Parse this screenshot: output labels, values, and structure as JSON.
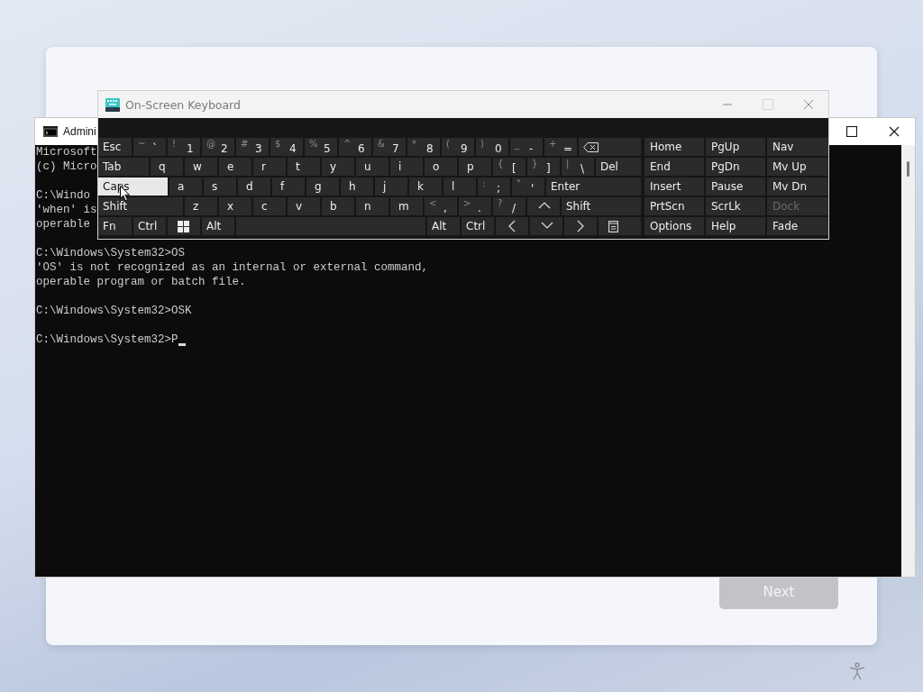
{
  "setup_card": {
    "next_button": {
      "label": "Next",
      "disabled": true
    }
  },
  "cmd_window": {
    "title": "Admini",
    "blocks": [
      [
        "Microsoft",
        "(c) Micro"
      ],
      [
        "C:\\Windo",
        "'when' is",
        "operable"
      ],
      [
        "C:\\Windows\\System32>OS",
        "'OS' is not recognized as an internal or external command,",
        "operable program or batch file."
      ],
      [
        "C:\\Windows\\System32>OSK"
      ],
      [
        "C:\\Windows\\System32>P"
      ]
    ]
  },
  "osk": {
    "title": "On-Screen Keyboard",
    "rows": [
      [
        {
          "kind": "label",
          "label": "Esc",
          "highlighted": false
        },
        {
          "kind": "pair",
          "shift": "~",
          "label": "`",
          "highlighted": false
        },
        {
          "kind": "pair",
          "shift": "!",
          "label": "1",
          "highlighted": false
        },
        {
          "kind": "pair",
          "shift": "@",
          "label": "2",
          "highlighted": false
        },
        {
          "kind": "pair",
          "shift": "#",
          "label": "3",
          "highlighted": false
        },
        {
          "kind": "pair",
          "shift": "$",
          "label": "4",
          "highlighted": false
        },
        {
          "kind": "pair",
          "shift": "%",
          "label": "5",
          "highlighted": false
        },
        {
          "kind": "pair",
          "shift": "^",
          "label": "6",
          "highlighted": false
        },
        {
          "kind": "pair",
          "shift": "&",
          "label": "7",
          "highlighted": false
        },
        {
          "kind": "pair",
          "shift": "*",
          "label": "8",
          "highlighted": false
        },
        {
          "kind": "pair",
          "shift": "(",
          "label": "9",
          "highlighted": false
        },
        {
          "kind": "pair",
          "shift": ")",
          "label": "0",
          "highlighted": false
        },
        {
          "kind": "pair",
          "shift": "_",
          "label": "-",
          "highlighted": false
        },
        {
          "kind": "pair",
          "shift": "+",
          "label": "=",
          "highlighted": false
        },
        {
          "kind": "backspace",
          "highlighted": false
        }
      ],
      [
        {
          "kind": "label",
          "label": "Tab",
          "highlighted": false
        },
        {
          "kind": "char",
          "label": "q",
          "highlighted": false
        },
        {
          "kind": "char",
          "label": "w",
          "highlighted": false
        },
        {
          "kind": "char",
          "label": "e",
          "highlighted": false
        },
        {
          "kind": "char",
          "label": "r",
          "highlighted": false
        },
        {
          "kind": "char",
          "label": "t",
          "highlighted": false
        },
        {
          "kind": "char",
          "label": "y",
          "highlighted": false
        },
        {
          "kind": "char",
          "label": "u",
          "highlighted": false
        },
        {
          "kind": "char",
          "label": "i",
          "highlighted": false
        },
        {
          "kind": "char",
          "label": "o",
          "highlighted": false
        },
        {
          "kind": "char",
          "label": "p",
          "highlighted": false
        },
        {
          "kind": "pair",
          "shift": "{",
          "label": "[",
          "highlighted": false
        },
        {
          "kind": "pair",
          "shift": "}",
          "label": "]",
          "highlighted": false
        },
        {
          "kind": "pair",
          "shift": "|",
          "label": "\\",
          "highlighted": false
        },
        {
          "kind": "label",
          "label": "Del",
          "highlighted": false
        }
      ],
      [
        {
          "kind": "label",
          "label": "Caps",
          "highlighted": true
        },
        {
          "kind": "char",
          "label": "a",
          "highlighted": false
        },
        {
          "kind": "char",
          "label": "s",
          "highlighted": false
        },
        {
          "kind": "char",
          "label": "d",
          "highlighted": false
        },
        {
          "kind": "char",
          "label": "f",
          "highlighted": false
        },
        {
          "kind": "char",
          "label": "g",
          "highlighted": false
        },
        {
          "kind": "char",
          "label": "h",
          "highlighted": false
        },
        {
          "kind": "char",
          "label": "j",
          "highlighted": false
        },
        {
          "kind": "char",
          "label": "k",
          "highlighted": false
        },
        {
          "kind": "char",
          "label": "l",
          "highlighted": false
        },
        {
          "kind": "pair",
          "shift": ":",
          "label": ";",
          "highlighted": false
        },
        {
          "kind": "pair",
          "shift": "\"",
          "label": "'",
          "highlighted": false
        },
        {
          "kind": "label",
          "label": "Enter",
          "highlighted": false
        }
      ],
      [
        {
          "kind": "label",
          "label": "Shift",
          "highlighted": false
        },
        {
          "kind": "char",
          "label": "z",
          "highlighted": false
        },
        {
          "kind": "char",
          "label": "x",
          "highlighted": false
        },
        {
          "kind": "char",
          "label": "c",
          "highlighted": false
        },
        {
          "kind": "char",
          "label": "v",
          "highlighted": false
        },
        {
          "kind": "char",
          "label": "b",
          "highlighted": false
        },
        {
          "kind": "char",
          "label": "n",
          "highlighted": false
        },
        {
          "kind": "char",
          "label": "m",
          "highlighted": false
        },
        {
          "kind": "pair",
          "shift": "<",
          "label": ",",
          "highlighted": false
        },
        {
          "kind": "pair",
          "shift": ">",
          "label": ".",
          "highlighted": false
        },
        {
          "kind": "pair",
          "shift": "?",
          "label": "/",
          "highlighted": false
        },
        {
          "kind": "up",
          "highlighted": false
        },
        {
          "kind": "label",
          "label": "Shift",
          "highlighted": false
        }
      ],
      [
        {
          "kind": "label",
          "label": "Fn",
          "highlighted": false
        },
        {
          "kind": "label",
          "label": "Ctrl",
          "highlighted": false
        },
        {
          "kind": "windows",
          "highlighted": false
        },
        {
          "kind": "label",
          "label": "Alt",
          "highlighted": false
        },
        {
          "kind": "space",
          "highlighted": false
        },
        {
          "kind": "label",
          "label": "Alt",
          "highlighted": false
        },
        {
          "kind": "label",
          "label": "Ctrl",
          "highlighted": false
        },
        {
          "kind": "left",
          "highlighted": false
        },
        {
          "kind": "down",
          "highlighted": false
        },
        {
          "kind": "right",
          "highlighted": false
        },
        {
          "kind": "menu",
          "highlighted": false
        }
      ]
    ],
    "side_rows": [
      [
        {
          "label": "Home",
          "disabled": false
        },
        {
          "label": "PgUp",
          "disabled": false
        },
        {
          "label": "Nav",
          "disabled": false
        }
      ],
      [
        {
          "label": "End",
          "disabled": false
        },
        {
          "label": "PgDn",
          "disabled": false
        },
        {
          "label": "Mv Up",
          "disabled": false
        }
      ],
      [
        {
          "label": "Insert",
          "disabled": false
        },
        {
          "label": "Pause",
          "disabled": false
        },
        {
          "label": "Mv Dn",
          "disabled": false
        }
      ],
      [
        {
          "label": "PrtScn",
          "disabled": false
        },
        {
          "label": "ScrLk",
          "disabled": false
        },
        {
          "label": "Dock",
          "disabled": true
        }
      ],
      [
        {
          "label": "Options",
          "disabled": false
        },
        {
          "label": "Help",
          "disabled": false
        },
        {
          "label": "Fade",
          "disabled": false
        }
      ]
    ]
  }
}
